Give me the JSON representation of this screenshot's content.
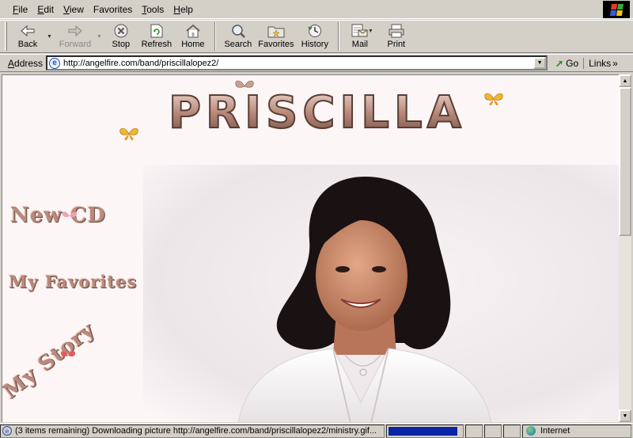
{
  "menubar": {
    "items": [
      {
        "label": "File",
        "accel": "F",
        "rest": "ile"
      },
      {
        "label": "Edit",
        "accel": "E",
        "rest": "dit"
      },
      {
        "label": "View",
        "accel": "V",
        "rest": "iew"
      },
      {
        "label": "Favorites",
        "accel": "F",
        "rest": "avorites",
        "before": "",
        "accelIndex": 0
      },
      {
        "label": "Tools",
        "accel": "T",
        "rest": "ools"
      },
      {
        "label": "Help",
        "accel": "H",
        "rest": "elp"
      }
    ]
  },
  "toolbar": {
    "back": "Back",
    "forward": "Forward",
    "stop": "Stop",
    "refresh": "Refresh",
    "home": "Home",
    "search": "Search",
    "favorites": "Favorites",
    "history": "History",
    "mail": "Mail",
    "print": "Print"
  },
  "addressbar": {
    "label_accel": "A",
    "label_rest": "ddress",
    "url": "http://angelfire.com/band/priscillalopez2/",
    "go": "Go",
    "links": "Links"
  },
  "page": {
    "banner_title": "PRISCILLA",
    "nav_new_cd": "New CD",
    "nav_favorites": "My Favorites",
    "nav_story": "My Story"
  },
  "statusbar": {
    "text": "(3 items remaining) Downloading picture http://angelfire.com/band/priscillalopez2/ministry.gif...",
    "progress": 0.95,
    "zone": "Internet"
  },
  "colors": {
    "chrome": "#d4d0c8",
    "page_background": "#fdf6f7",
    "progress_fill": "#0b24a5",
    "banner_letter": "#c9a598"
  }
}
